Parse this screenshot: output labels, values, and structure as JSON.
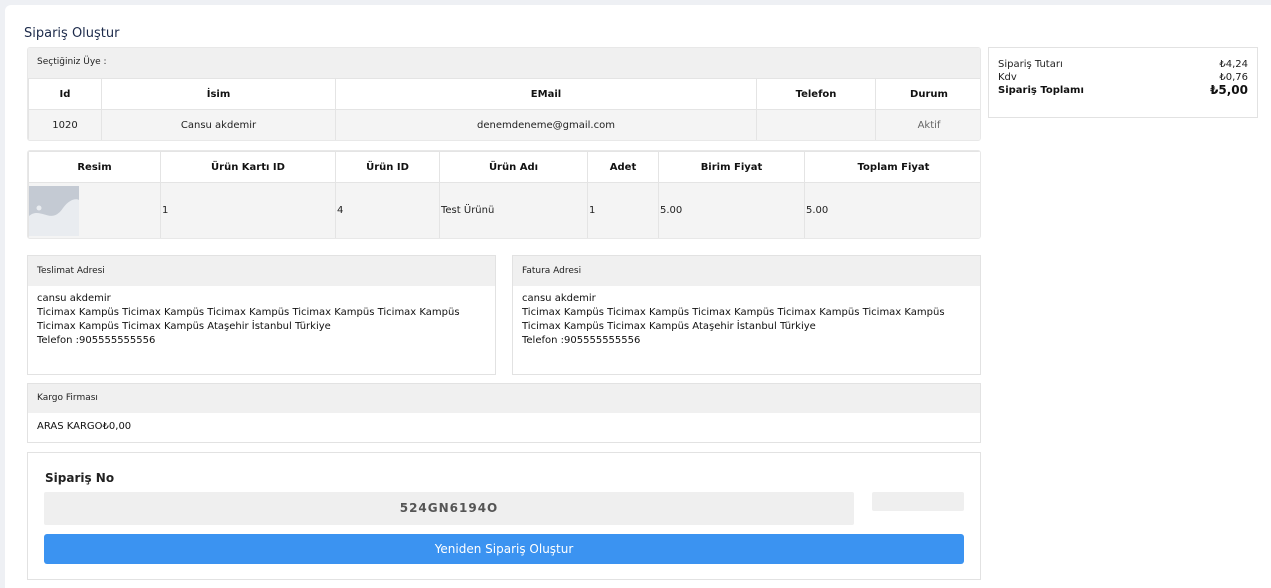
{
  "page": {
    "title": "Sipariş Oluştur"
  },
  "member": {
    "header": "Seçtiğiniz Üye :",
    "columns": [
      "Id",
      "İsim",
      "EMail",
      "Telefon",
      "Durum"
    ],
    "row": {
      "id": "1020",
      "name": "Cansu akdemir",
      "email": "denemdeneme@gmail.com",
      "phone": "",
      "status": "Aktif"
    }
  },
  "products": {
    "columns": [
      "Resim",
      "Ürün Kartı ID",
      "Ürün ID",
      "Ürün Adı",
      "Adet",
      "Birim Fiyat",
      "Toplam Fiyat"
    ],
    "rows": [
      {
        "image": "product-placeholder-image",
        "card_id": "1",
        "product_id": "4",
        "name": "Test Ürünü",
        "qty": "1",
        "unit_price": "5.00",
        "total_price": "5.00"
      }
    ]
  },
  "shipping": {
    "header": "Teslimat Adresi",
    "name": "cansu akdemir",
    "address_line1": "Ticimax Kampüs Ticimax Kampüs Ticimax Kampüs Ticimax Kampüs Ticimax Kampüs",
    "address_line2": "Ticimax Kampüs Ticimax Kampüs Ataşehir İstanbul Türkiye",
    "phone": "Telefon :905555555556"
  },
  "billing": {
    "header": "Fatura Adresi",
    "name": "cansu akdemir",
    "address_line1": "Ticimax Kampüs Ticimax Kampüs Ticimax Kampüs Ticimax Kampüs Ticimax Kampüs",
    "address_line2": "Ticimax Kampüs Ticimax Kampüs Ataşehir İstanbul Türkiye",
    "phone": "Telefon :905555555556"
  },
  "cargo": {
    "header": "Kargo Firması",
    "value": "ARAS KARGO₺0,00"
  },
  "order": {
    "label": "Sipariş No",
    "number": "524GN6194O",
    "reorder_label": "Yeniden Sipariş Oluştur"
  },
  "summary": {
    "subtotal_label": "Sipariş Tutarı",
    "subtotal_value": "₺4,24",
    "tax_label": "Kdv",
    "tax_value": "₺0,76",
    "total_label": "Sipariş Toplamı",
    "total_value": "₺5,00"
  },
  "colors": {
    "accent": "#3b93f1",
    "price_red": "#e57373",
    "header_bg": "#f0f0f0"
  }
}
